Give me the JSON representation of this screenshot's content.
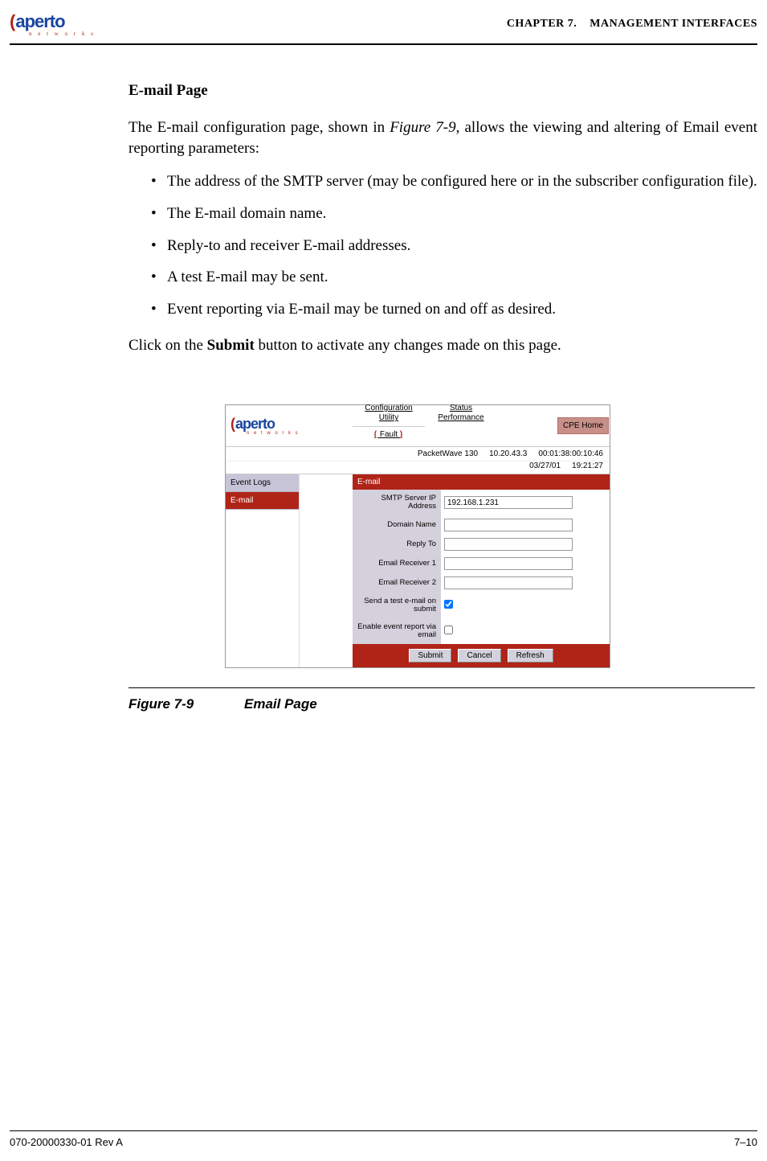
{
  "header": {
    "logo_name": "aperto",
    "logo_sub": "n e t w o r k s",
    "chapter_label": "CHAPTER 7.",
    "chapter_title": "MANAGEMENT INTERFACES"
  },
  "section": {
    "heading": "E-mail Page",
    "intro_a": "The E-mail configuration page, shown in ",
    "intro_ref": "Figure 7-9",
    "intro_b": ", allows the viewing and altering of Email event reporting parameters:",
    "bullets": [
      "The address of the SMTP server (may be configured here or in the subscriber configuration file).",
      "The E-mail domain name.",
      "Reply-to and receiver E-mail addresses.",
      "A test E-mail may be sent.",
      "Event reporting via E-mail may be turned on and off as desired."
    ],
    "closing_a": "Click on the ",
    "closing_bold": "Submit",
    "closing_b": " button to activate any changes made on this page."
  },
  "mini_ui": {
    "logo_name": "aperto",
    "logo_sub": "n e t w o r k s",
    "tabs": {
      "config": "Configuration Utility",
      "status": "Status Performance",
      "fault": "Fault"
    },
    "cpe_home": "CPE Home",
    "device": "PacketWave 130",
    "ip": "10.20.43.3",
    "mac": "00:01:38:00:10:46",
    "date": "03/27/01",
    "time": "19:21:27",
    "sidebar": {
      "event_logs": "Event Logs",
      "email": "E-mail"
    },
    "panel_title": "E-mail",
    "fields": {
      "smtp_label": "SMTP Server IP Address",
      "smtp_value": "192.168.1.231",
      "domain_label": "Domain Name",
      "domain_value": "",
      "reply_label": "Reply To",
      "reply_value": "",
      "recv1_label": "Email Receiver 1",
      "recv1_value": "",
      "recv2_label": "Email Receiver 2",
      "recv2_value": "",
      "test_label": "Send a test e-mail on submit",
      "enable_label": "Enable event report via email"
    },
    "buttons": {
      "submit": "Submit",
      "cancel": "Cancel",
      "refresh": "Refresh"
    }
  },
  "figure": {
    "number": "Figure 7-9",
    "title": "Email Page"
  },
  "footer": {
    "doc_id": "070-20000330-01 Rev A",
    "page": "7–10"
  }
}
